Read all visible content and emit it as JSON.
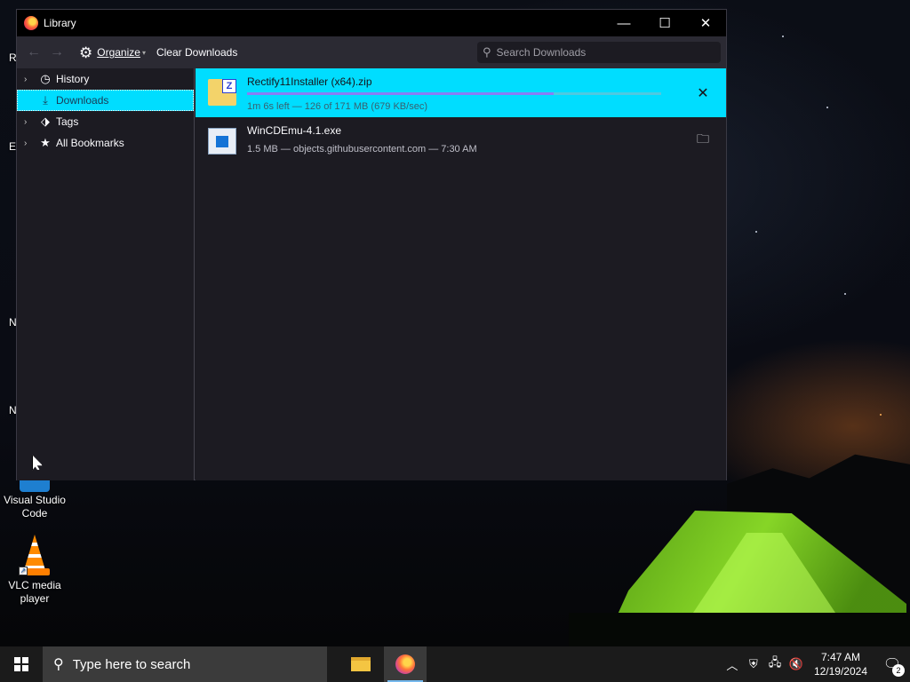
{
  "window": {
    "title": "Library",
    "controls": {
      "minimize": "—",
      "maximize": "☐",
      "close": "✕"
    }
  },
  "toolbar": {
    "back_icon": "back-arrow",
    "forward_icon": "forward-arrow",
    "organize_label": "Organize",
    "clear_downloads_label": "Clear Downloads",
    "search_placeholder": "Search Downloads"
  },
  "sidebar": {
    "items": [
      {
        "label": "History",
        "icon": "clock-icon",
        "expandable": true,
        "selected": false
      },
      {
        "label": "Downloads",
        "icon": "download-icon",
        "expandable": false,
        "selected": true
      },
      {
        "label": "Tags",
        "icon": "tag-icon",
        "expandable": true,
        "selected": false
      },
      {
        "label": "All Bookmarks",
        "icon": "star-icon",
        "expandable": true,
        "selected": false
      }
    ]
  },
  "downloads": [
    {
      "name": "Rectify11Installer (x64).zip",
      "status": "1m 6s left — 126 of 171 MB (679 KB/sec)",
      "progress": 0.74,
      "state": "in-progress",
      "action_icon": "cancel-icon"
    },
    {
      "name": "WinCDEmu-4.1.exe",
      "status": "1.5 MB — objects.githubusercontent.com — 7:30 AM",
      "state": "completed",
      "action_icon": "folder-icon"
    }
  ],
  "desktop": {
    "icons": [
      {
        "label": "Visual Studio Code"
      },
      {
        "label": "VLC media player"
      }
    ],
    "edge_fragments": [
      "R",
      "E",
      "N",
      "N"
    ]
  },
  "taskbar": {
    "search_placeholder": "Type here to search",
    "clock_time": "7:47 AM",
    "clock_date": "12/19/2024",
    "notification_count": "2"
  },
  "colors": {
    "accent": "#00ddff",
    "window_bg": "#1c1b22",
    "toolbar_bg": "#2b2a33",
    "progress": "#8b7cf5",
    "taskbar_bg": "#1b1b1b"
  }
}
